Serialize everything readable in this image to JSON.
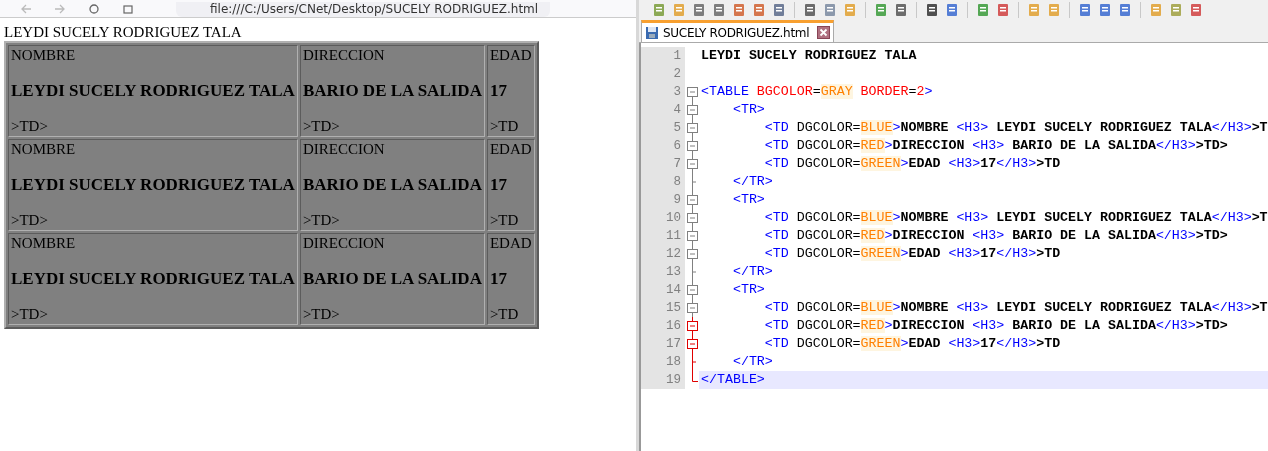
{
  "browser": {
    "address": "file:///C:/Users/CNet/Desktop/SUCELY RODRIGUEZ.html",
    "heading": "LEYDI SUCELY RODRIGUEZ TALA",
    "table": {
      "rows": [
        {
          "cells": [
            {
              "label": "NOMBRE",
              "value": "LEYDI SUCELY RODRIGUEZ TALA",
              "tail": ">TD>"
            },
            {
              "label": "DIRECCION",
              "value": "BARIO DE LA SALIDA",
              "tail": ">TD>"
            },
            {
              "label": "EDAD",
              "value": "17",
              "tail": ">TD"
            }
          ]
        },
        {
          "cells": [
            {
              "label": "NOMBRE",
              "value": "LEYDI SUCELY RODRIGUEZ TALA",
              "tail": ">TD>"
            },
            {
              "label": "DIRECCION",
              "value": "BARIO DE LA SALIDA",
              "tail": ">TD>"
            },
            {
              "label": "EDAD",
              "value": "17",
              "tail": ">TD"
            }
          ]
        },
        {
          "cells": [
            {
              "label": "NOMBRE",
              "value": "LEYDI SUCELY RODRIGUEZ TALA",
              "tail": ">TD>"
            },
            {
              "label": "DIRECCION",
              "value": "BARIO DE LA SALIDA",
              "tail": ">TD>"
            },
            {
              "label": "EDAD",
              "value": "17",
              "tail": ">TD"
            }
          ]
        }
      ]
    }
  },
  "editor": {
    "tabs": [
      {
        "title": "SUCELY RODRIGUEZ.html",
        "selected": true
      }
    ],
    "lines": [
      {
        "number": "1",
        "kind": "plain",
        "current": false,
        "tokens": [
          {
            "kind": "text",
            "text": "LEYDI SUCELY RODRIGUEZ TALA"
          }
        ]
      },
      {
        "number": "2",
        "kind": "plain",
        "current": false
      },
      {
        "number": "3",
        "kind": "start",
        "marked": false,
        "current": false,
        "tokens": [
          {
            "kind": "tag",
            "text": "<TABLE"
          },
          {
            "kind": "attr",
            "text": " BGCOLOR"
          },
          {
            "kind": "plain",
            "text": "="
          },
          {
            "kind": "value",
            "text": "GRAY"
          },
          {
            "kind": "attr",
            "text": " BORDER"
          },
          {
            "kind": "plain",
            "text": "="
          },
          {
            "kind": "attr",
            "text": "2"
          },
          {
            "kind": "tag",
            "text": ">"
          }
        ]
      },
      {
        "number": "4",
        "kind": "box",
        "marked": false,
        "current": false,
        "tokens": [
          {
            "kind": "tag",
            "text": "    <TR>"
          }
        ]
      },
      {
        "number": "5",
        "kind": "box",
        "marked": false,
        "current": false,
        "tokens": [
          {
            "kind": "tag",
            "text": "        <TD"
          },
          {
            "kind": "plain",
            "text": " DGCOLOR="
          },
          {
            "kind": "value",
            "text": "BLUE"
          },
          {
            "kind": "tag",
            "text": ">"
          },
          {
            "kind": "text",
            "text": "NOMBRE "
          },
          {
            "kind": "tag",
            "text": "<H3>"
          },
          {
            "kind": "text",
            "text": " LEYDI SUCELY RODRIGUEZ TALA"
          },
          {
            "kind": "tag",
            "text": "</H3>"
          },
          {
            "kind": "text",
            "text": ">T"
          }
        ]
      },
      {
        "number": "6",
        "kind": "box",
        "marked": false,
        "current": false,
        "tokens": [
          {
            "kind": "tag",
            "text": "        <TD"
          },
          {
            "kind": "plain",
            "text": " DGCOLOR="
          },
          {
            "kind": "value",
            "text": "RED"
          },
          {
            "kind": "tag",
            "text": ">"
          },
          {
            "kind": "text",
            "text": "DIRECCION "
          },
          {
            "kind": "tag",
            "text": "<H3>"
          },
          {
            "kind": "text",
            "text": " BARIO DE LA SALIDA"
          },
          {
            "kind": "tag",
            "text": "</H3>"
          },
          {
            "kind": "text",
            "text": ">TD>"
          }
        ]
      },
      {
        "number": "7",
        "kind": "box",
        "marked": false,
        "current": false,
        "tokens": [
          {
            "kind": "tag",
            "text": "        <TD"
          },
          {
            "kind": "plain",
            "text": " DGCOLOR="
          },
          {
            "kind": "value",
            "text": "GREEN"
          },
          {
            "kind": "tag",
            "text": ">"
          },
          {
            "kind": "text",
            "text": "EDAD "
          },
          {
            "kind": "tag",
            "text": "<H3>"
          },
          {
            "kind": "text",
            "text": "17"
          },
          {
            "kind": "tag",
            "text": "</H3>"
          },
          {
            "kind": "text",
            "text": ">TD"
          }
        ]
      },
      {
        "number": "8",
        "kind": "tick",
        "marked": false,
        "current": false,
        "tokens": [
          {
            "kind": "tag",
            "text": "    </TR>"
          }
        ]
      },
      {
        "number": "9",
        "kind": "box",
        "marked": false,
        "current": false,
        "tokens": [
          {
            "kind": "tag",
            "text": "    <TR>"
          }
        ]
      },
      {
        "number": "10",
        "kind": "box",
        "marked": false,
        "current": false,
        "tokens": [
          {
            "kind": "tag",
            "text": "        <TD"
          },
          {
            "kind": "plain",
            "text": " DGCOLOR="
          },
          {
            "kind": "value",
            "text": "BLUE"
          },
          {
            "kind": "tag",
            "text": ">"
          },
          {
            "kind": "text",
            "text": "NOMBRE "
          },
          {
            "kind": "tag",
            "text": "<H3>"
          },
          {
            "kind": "text",
            "text": " LEYDI SUCELY RODRIGUEZ TALA"
          },
          {
            "kind": "tag",
            "text": "</H3>"
          },
          {
            "kind": "text",
            "text": ">T"
          }
        ]
      },
      {
        "number": "11",
        "kind": "box",
        "marked": false,
        "current": false,
        "tokens": [
          {
            "kind": "tag",
            "text": "        <TD"
          },
          {
            "kind": "plain",
            "text": " DGCOLOR="
          },
          {
            "kind": "value",
            "text": "RED"
          },
          {
            "kind": "tag",
            "text": ">"
          },
          {
            "kind": "text",
            "text": "DIRECCION "
          },
          {
            "kind": "tag",
            "text": "<H3>"
          },
          {
            "kind": "text",
            "text": " BARIO DE LA SALIDA"
          },
          {
            "kind": "tag",
            "text": "</H3>"
          },
          {
            "kind": "text",
            "text": ">TD>"
          }
        ]
      },
      {
        "number": "12",
        "kind": "box",
        "marked": false,
        "current": false,
        "tokens": [
          {
            "kind": "tag",
            "text": "        <TD"
          },
          {
            "kind": "plain",
            "text": " DGCOLOR="
          },
          {
            "kind": "value",
            "text": "GREEN"
          },
          {
            "kind": "tag",
            "text": ">"
          },
          {
            "kind": "text",
            "text": "EDAD "
          },
          {
            "kind": "tag",
            "text": "<H3>"
          },
          {
            "kind": "text",
            "text": "17"
          },
          {
            "kind": "tag",
            "text": "</H3>"
          },
          {
            "kind": "text",
            "text": ">TD"
          }
        ]
      },
      {
        "number": "13",
        "kind": "tick",
        "marked": false,
        "current": false,
        "tokens": [
          {
            "kind": "tag",
            "text": "    </TR>"
          }
        ]
      },
      {
        "number": "14",
        "kind": "box",
        "marked": false,
        "current": false,
        "tokens": [
          {
            "kind": "tag",
            "text": "    <TR>"
          }
        ]
      },
      {
        "number": "15",
        "kind": "box",
        "marked": false,
        "current": false,
        "tokens": [
          {
            "kind": "tag",
            "text": "        <TD"
          },
          {
            "kind": "plain",
            "text": " DGCOLOR="
          },
          {
            "kind": "value",
            "text": "BLUE"
          },
          {
            "kind": "tag",
            "text": ">"
          },
          {
            "kind": "text",
            "text": "NOMBRE "
          },
          {
            "kind": "tag",
            "text": "<H3>"
          },
          {
            "kind": "text",
            "text": " LEYDI SUCELY RODRIGUEZ TALA"
          },
          {
            "kind": "tag",
            "text": "</H3>"
          },
          {
            "kind": "text",
            "text": ">T"
          }
        ]
      },
      {
        "number": "16",
        "kind": "box",
        "marked": true,
        "current": false,
        "tokens": [
          {
            "kind": "tag",
            "text": "        <TD"
          },
          {
            "kind": "plain",
            "text": " DGCOLOR="
          },
          {
            "kind": "value",
            "text": "RED"
          },
          {
            "kind": "tag",
            "text": ">"
          },
          {
            "kind": "text",
            "text": "DIRECCION "
          },
          {
            "kind": "tag",
            "text": "<H3>"
          },
          {
            "kind": "text",
            "text": " BARIO DE LA SALIDA"
          },
          {
            "kind": "tag",
            "text": "</H3>"
          },
          {
            "kind": "text",
            "text": ">TD>"
          }
        ]
      },
      {
        "number": "17",
        "kind": "box",
        "marked": true,
        "current": false,
        "tokens": [
          {
            "kind": "tag",
            "text": "        <TD"
          },
          {
            "kind": "plain",
            "text": " DGCOLOR="
          },
          {
            "kind": "value",
            "text": "GREEN"
          },
          {
            "kind": "tag",
            "text": ">"
          },
          {
            "kind": "text",
            "text": "EDAD "
          },
          {
            "kind": "tag",
            "text": "<H3>"
          },
          {
            "kind": "text",
            "text": "17"
          },
          {
            "kind": "tag",
            "text": "</H3>"
          },
          {
            "kind": "text",
            "text": ">TD"
          }
        ]
      },
      {
        "number": "18",
        "kind": "tick",
        "marked": true,
        "current": false,
        "tokens": [
          {
            "kind": "tag",
            "text": "    </TR>"
          }
        ]
      },
      {
        "number": "19",
        "kind": "end",
        "marked": true,
        "current": true,
        "tokens": [
          {
            "kind": "tag",
            "text": "</TABLE>"
          }
        ]
      }
    ]
  }
}
